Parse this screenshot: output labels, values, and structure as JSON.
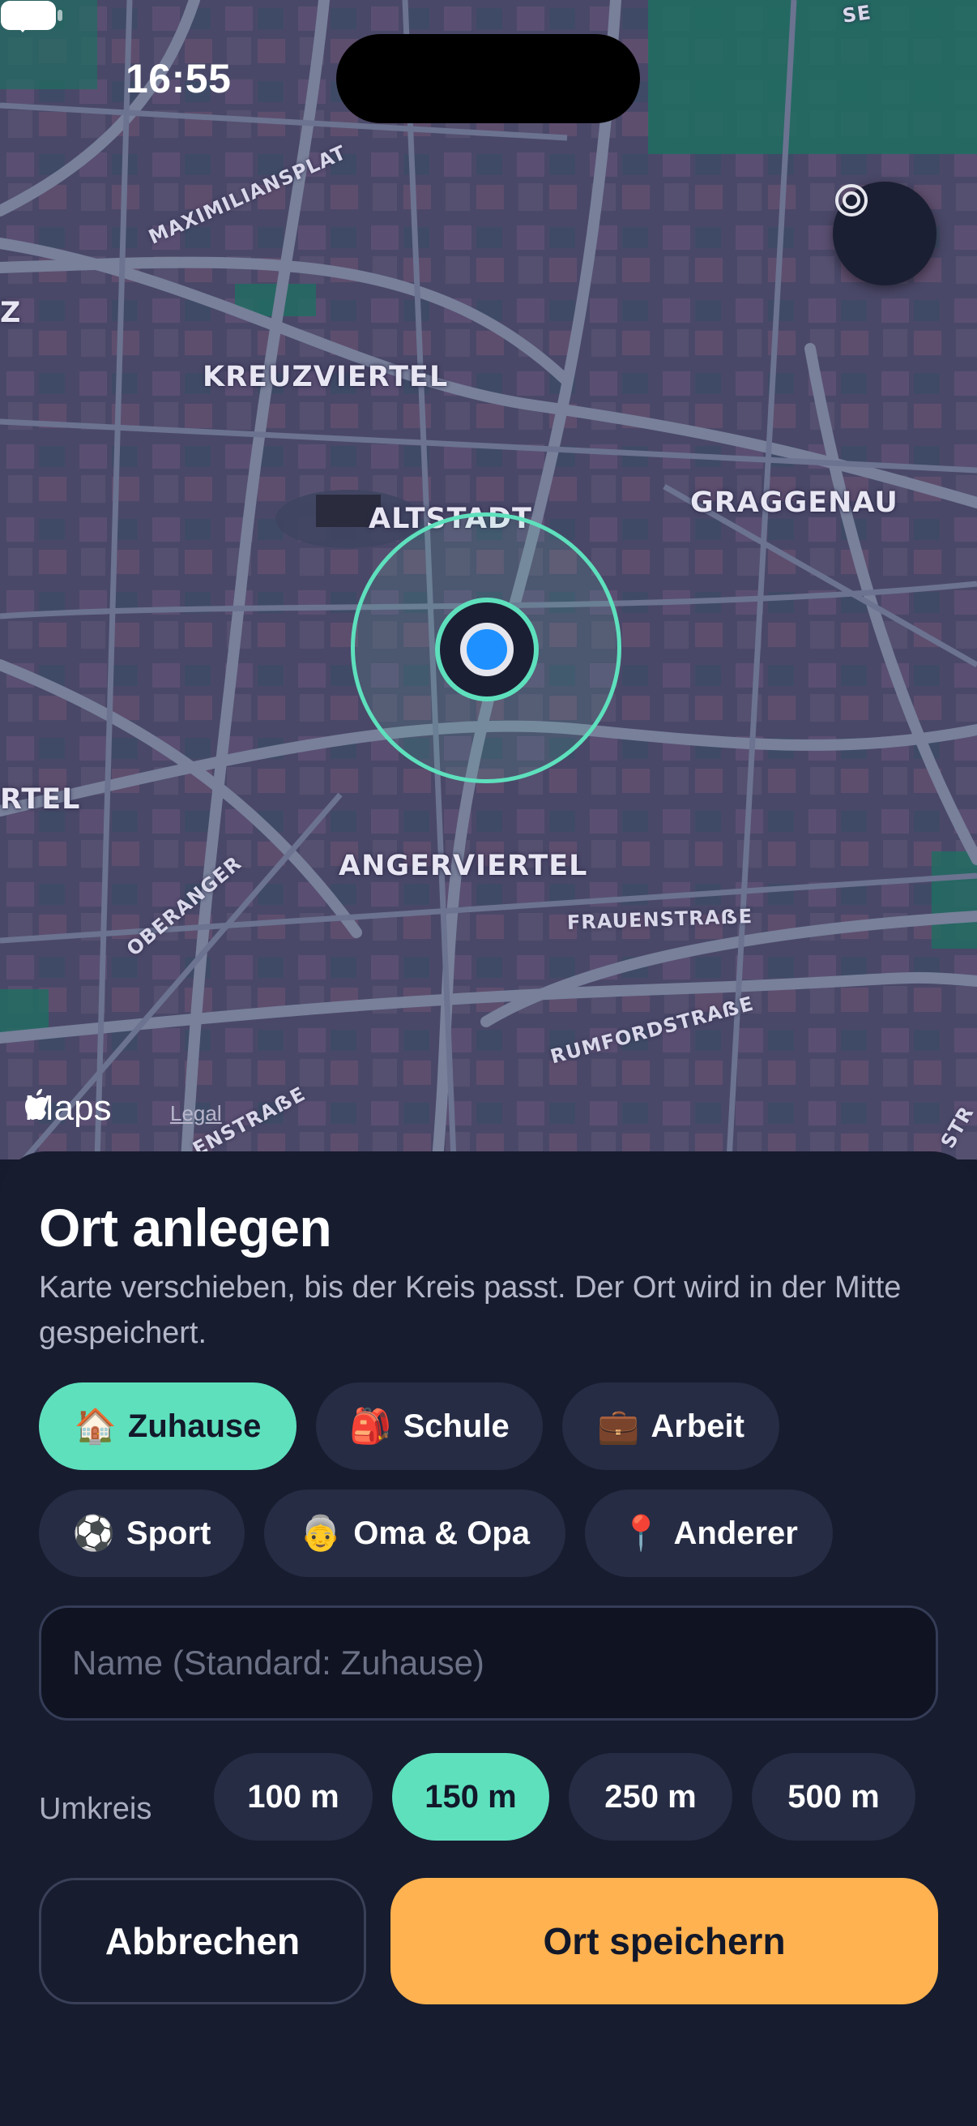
{
  "status_bar": {
    "time": "16:55"
  },
  "map": {
    "districts": {
      "kreuzviertel": "KREUZVIERTEL",
      "altstadt": "ALTSTADT",
      "graggenau": "GRAGGENAU",
      "angerviertel": "ANGERVIERTEL",
      "rtel_fragment": "RTEL",
      "z_fragment": "Z"
    },
    "streets": {
      "maximiliansplatz": "MAXIMILIANSPLAT",
      "oberanger": "OBERANGER",
      "frauenstrasse": "FRAUENSTRAẞE",
      "rumfordstrasse": "RUMFORDSTRAẞE",
      "sendlinger": "ENSTRAẞE",
      "str_fragment": "STR",
      "se_fragment": "SE"
    },
    "attribution": {
      "maps_logo": "Maps",
      "legal": "Legal"
    },
    "locate_icon": "target-icon",
    "colors": {
      "radius_ring": "#5ee0bd",
      "location_dot": "#1e90ff"
    }
  },
  "sheet": {
    "title": "Ort anlegen",
    "subtitle": "Karte verschieben, bis der Kreis passt. Der Ort wird in der Mitte gespeichert.",
    "categories": [
      {
        "emoji": "🏠",
        "label": "Zuhause",
        "active": true
      },
      {
        "emoji": "🎒",
        "label": "Schule",
        "active": false
      },
      {
        "emoji": "💼",
        "label": "Arbeit",
        "active": false
      },
      {
        "emoji": "⚽",
        "label": "Sport",
        "active": false
      },
      {
        "emoji": "👵",
        "label": "Oma & Opa",
        "active": false
      },
      {
        "emoji": "📍",
        "label": "Anderer",
        "active": false
      }
    ],
    "name_input": {
      "value": "",
      "placeholder": "Name (Standard: Zuhause)"
    },
    "radius": {
      "label": "Umkreis",
      "options": [
        "100 m",
        "150 m",
        "250 m",
        "500 m"
      ],
      "selected": "150 m"
    },
    "buttons": {
      "cancel": "Abbrechen",
      "save": "Ort speichern"
    },
    "colors": {
      "accent": "#5ee0bd",
      "primary_button": "#ffb24f"
    }
  }
}
